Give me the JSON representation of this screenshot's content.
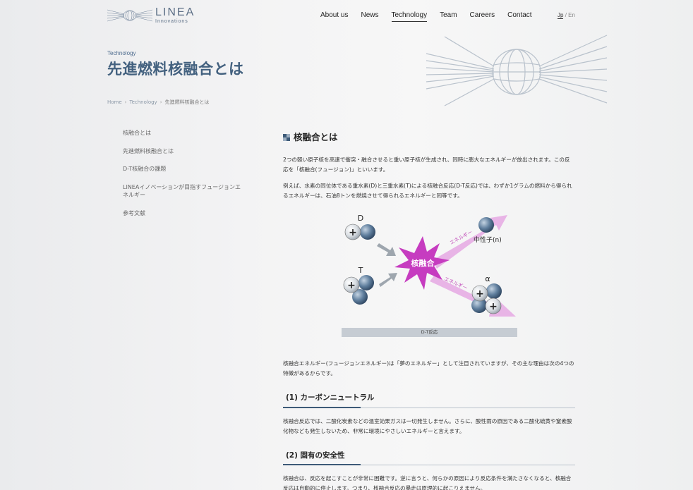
{
  "header": {
    "logo_main": "LINEA",
    "logo_sub": "Innovations",
    "nav": [
      "About us",
      "News",
      "Technology",
      "Team",
      "Careers",
      "Contact"
    ],
    "active_nav": "Technology",
    "lang_jp": "Jp",
    "lang_sep": "/",
    "lang_en": "En"
  },
  "page": {
    "category": "Technology",
    "title": "先進燃料核融合とは",
    "breadcrumb": [
      "Home",
      "Technology",
      "先進燃料核融合とは"
    ],
    "breadcrumb_sep": "›"
  },
  "sidebar": {
    "items": [
      "核融合とは",
      "先進燃料核融合とは",
      "D-T核融合の課題",
      "LINEAイノベーションが目指すフュージョンエネルギー",
      "参考文献"
    ]
  },
  "content": {
    "section_title": "核融合とは",
    "p1": "2つの軽い原子核を高速で衝突・融合させると重い原子核が生成され、同時に膨大なエネルギーが放出されます。この反応を「核融合(フュージョン)」といいます。",
    "p2": "例えば、水素の同位体である重水素(D)と三重水素(T)による核融合反応(D-T反応)では、わずか1グラムの燃料から得られるエネルギーは、石油8トンを燃焼させて得られるエネルギーと同等です。",
    "figure": {
      "label_d": "D",
      "label_t": "T",
      "label_fusion": "核融合",
      "label_neutron": "中性子(n)",
      "label_alpha": "α",
      "label_energy": "エネルギー",
      "plus": "+",
      "caption": "D-T反応"
    },
    "p3": "核融合エネルギー(フュージョンエネルギー)は「夢のエネルギー」として注目されていますが、その主な理由は次の4つの特徴があるからです。",
    "h1": "(1) カーボンニュートラル",
    "p4": "核融合反応では、二酸化炭素などの温室効果ガスは一切発生しません。さらに、酸性雨の原因である二酸化硫黄や窒素酸化物なども発生しないため、非常に環境にやさしいエネルギーと言えます。",
    "h2": "(2) 固有の安全性",
    "p5": "核融合は、反応を起こすことが非常に困難です。逆に言うと、何らかの原因により反応条件を満たさなくなると、核融合反応は自動的に停止します。つまり、核融合反応の暴走は原理的に起こりえません。"
  },
  "colors": {
    "heading": "#43617f",
    "fusion_burst": "#c63cc0",
    "energy_arrow": "#e4a9e2",
    "nucleus": "#5b7a99"
  }
}
